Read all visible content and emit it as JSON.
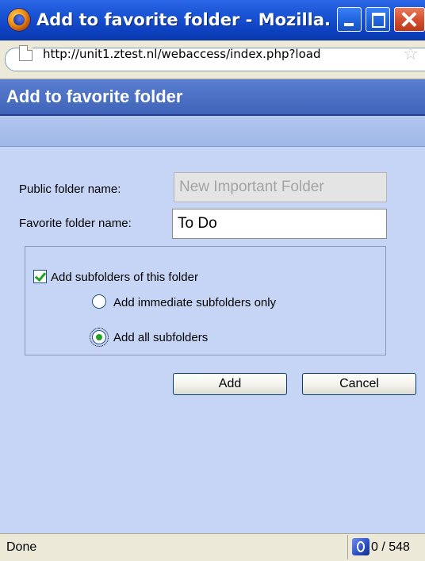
{
  "window": {
    "title": "Add to favorite folder - Mozilla...",
    "title_bar_color": "#1a55d6"
  },
  "address_bar": {
    "url": "http://unit1.ztest.nl/webaccess/index.php?load"
  },
  "dialog": {
    "title": "Add to favorite folder",
    "public_folder_label": "Public folder name:",
    "public_folder_value": "New Important Folder",
    "favorite_folder_label": "Favorite folder name:",
    "favorite_folder_value": "To Do",
    "add_subfolders_label": "Add subfolders of this folder",
    "add_subfolders_checked": true,
    "radio_immediate_label": "Add immediate subfolders only",
    "radio_all_label": "Add all subfolders",
    "radio_selected": "all",
    "add_button": "Add",
    "cancel_button": "Cancel",
    "background_color": "#c6d5f6"
  },
  "status_bar": {
    "status": "Done",
    "count": "0 / 548"
  },
  "icons": [
    "firefox-icon",
    "minimize-icon",
    "maximize-icon",
    "close-icon",
    "page-icon",
    "bookmark-star-icon",
    "status-counter-icon"
  ]
}
